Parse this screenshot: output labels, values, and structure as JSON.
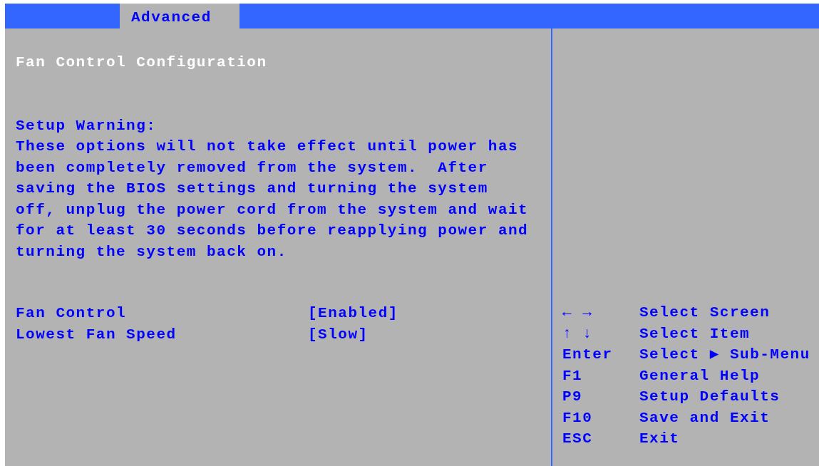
{
  "tabs": [
    {
      "label": "Advanced",
      "selected": true
    }
  ],
  "page_title": "Fan Control Configuration",
  "warning": {
    "title": "Setup Warning:",
    "lines": [
      "These options will not take effect until power has",
      "been completely removed from the system.  After",
      "saving the BIOS settings and turning the system",
      "off, unplug the power cord from the system and wait",
      "for at least 30 seconds before reapplying power and",
      "turning the system back on."
    ]
  },
  "settings": [
    {
      "label": "Fan Control",
      "value": "[Enabled]"
    },
    {
      "label": "Lowest Fan Speed",
      "value": "[Slow]"
    }
  ],
  "help_keys": [
    {
      "key": "← →",
      "action": "Select Screen"
    },
    {
      "key": "↑ ↓",
      "action": "Select Item"
    },
    {
      "key": "Enter",
      "action": "Select ▶ Sub-Menu"
    },
    {
      "key": "F1",
      "action": "General Help"
    },
    {
      "key": "P9",
      "action": "Setup Defaults"
    },
    {
      "key": "F10",
      "action": "Save and Exit"
    },
    {
      "key": "ESC",
      "action": "Exit"
    }
  ]
}
